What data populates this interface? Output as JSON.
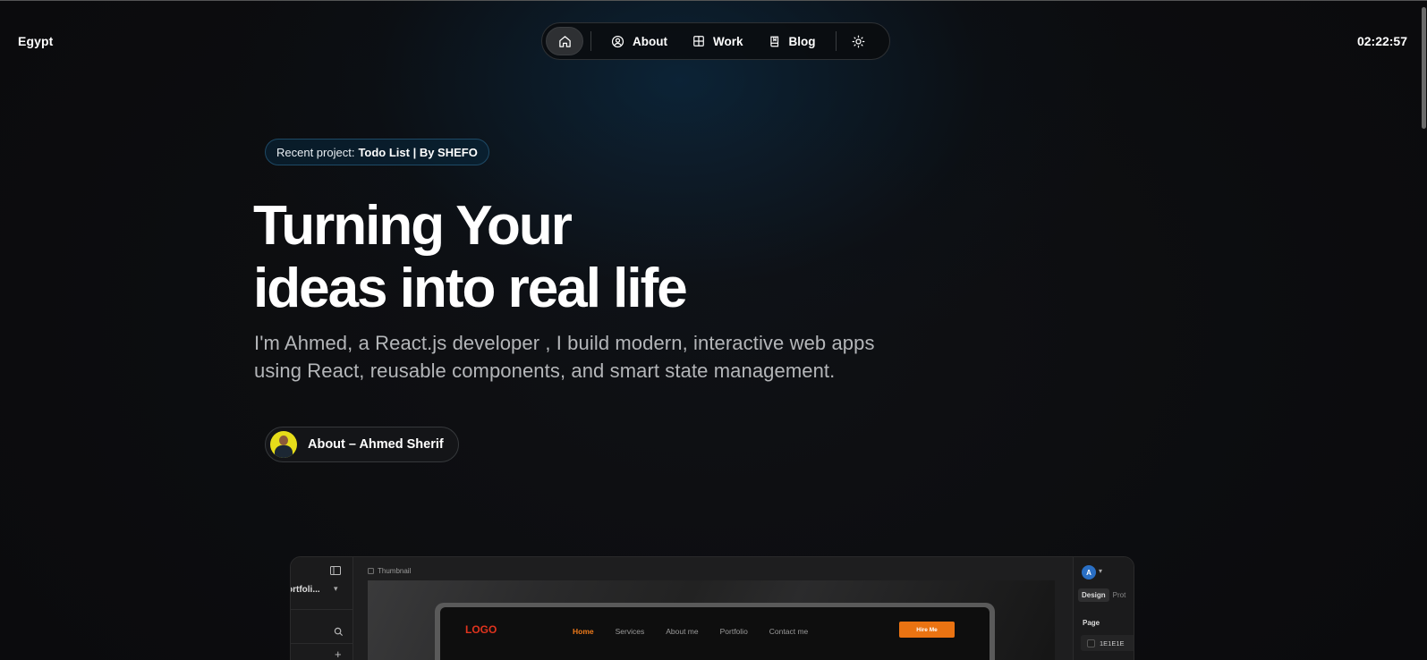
{
  "header": {
    "location": "Egypt",
    "clock": "02:22:57"
  },
  "nav": {
    "items": [
      {
        "label": "About",
        "icon": "user-circle-icon"
      },
      {
        "label": "Work",
        "icon": "grid-icon"
      },
      {
        "label": "Blog",
        "icon": "book-icon"
      }
    ],
    "home_icon": "home-icon",
    "theme_icon": "sun-icon"
  },
  "hero": {
    "badge_prefix": "Recent project:",
    "badge_project": "Todo List | By SHEFO",
    "headline_line1": "Turning Your",
    "headline_line2": "ideas into real life",
    "subtitle_main": "I'm Ahmed, a React.js developer , I build modern, interactive web apps",
    "subtitle_fade": "",
    "subtitle_line2": "using React, reusable components, and smart state management.",
    "about_button": "About – Ahmed Sherif"
  },
  "preview": {
    "project_name": "ortfoli...",
    "thumbnail_label": "Thumbnail",
    "site_logo": "LOGO",
    "site_menu": [
      "Home",
      "Services",
      "About me",
      "Portfolio",
      "Contact me"
    ],
    "hire_button": "Hire Me",
    "user_initial": "A",
    "tabs": [
      "Design",
      "Prot"
    ],
    "page_label": "Page",
    "page_color": "1E1E1E"
  },
  "colors": {
    "background": "#0b0b0d",
    "badge_border": "#1e4a66",
    "accent_orange": "#ea7312",
    "logo_red": "#e1341e",
    "avatar_yellow": "#e6dd1a"
  }
}
